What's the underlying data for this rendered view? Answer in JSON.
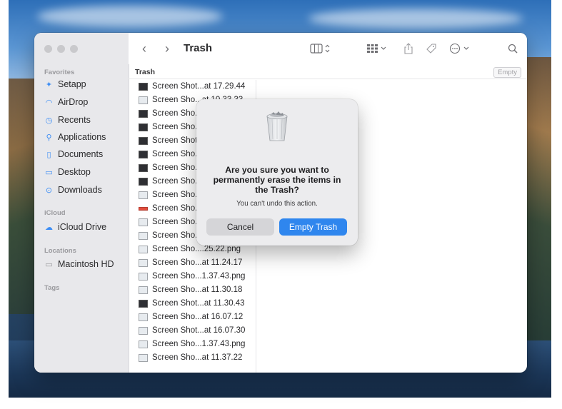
{
  "window": {
    "title": "Trash"
  },
  "sidebar": {
    "favorites_label": "Favorites",
    "items": [
      {
        "label": "Setapp",
        "icon": "setapp-icon"
      },
      {
        "label": "AirDrop",
        "icon": "airdrop-icon"
      },
      {
        "label": "Recents",
        "icon": "clock-icon"
      },
      {
        "label": "Applications",
        "icon": "applications-icon"
      },
      {
        "label": "Documents",
        "icon": "document-icon"
      },
      {
        "label": "Desktop",
        "icon": "desktop-icon"
      },
      {
        "label": "Downloads",
        "icon": "download-icon"
      }
    ],
    "icloud_label": "iCloud",
    "icloud_items": [
      {
        "label": "iCloud Drive",
        "icon": "cloud-icon"
      }
    ],
    "locations_label": "Locations",
    "location_items": [
      {
        "label": "Macintosh HD",
        "icon": "drive-icon"
      }
    ],
    "tags_label": "Tags"
  },
  "pathbar": {
    "label": "Trash",
    "empty_label": "Empty"
  },
  "files": [
    "Screen Shot...at 17.29.44",
    "Screen Sho...at 10.33.33",
    "Screen Sho...",
    "Screen Sho...",
    "Screen Shot...",
    "Screen Sho...",
    "Screen Sho...",
    "Screen Sho...",
    "Screen Sho...",
    "Screen Sho...",
    "Screen Sho...",
    "Screen Sho...",
    "Screen Sho....25.22.png",
    "Screen Sho...at 11.24.17",
    "Screen Sho...1.37.43.png",
    "Screen Sho...at 11.30.18",
    "Screen Shot...at 11.30.43",
    "Screen Sho...at 16.07.12",
    "Screen Shot...at 16.07.30",
    "Screen Sho...1.37.43.png",
    "Screen Sho...at 11.37.22"
  ],
  "dialog": {
    "title": "Are you sure you want to permanently erase the items in the Trash?",
    "message": "You can't undo this action.",
    "cancel_label": "Cancel",
    "confirm_label": "Empty Trash",
    "accent": "#2f86ee"
  }
}
